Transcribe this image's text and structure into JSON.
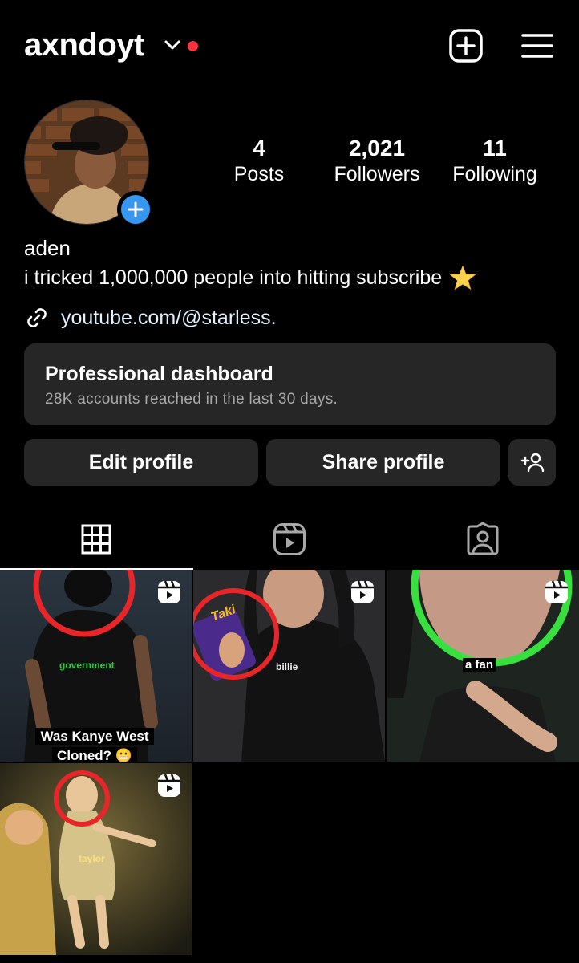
{
  "header": {
    "username": "axndoyt",
    "create_icon": "plus-square-icon",
    "menu_icon": "hamburger-menu-icon"
  },
  "profile": {
    "stats": [
      {
        "value": "4",
        "label": "Posts"
      },
      {
        "value": "2,021",
        "label": "Followers"
      },
      {
        "value": "11",
        "label": "Following"
      }
    ],
    "display_name": "aden",
    "bio": "i tricked 1,000,000 people into hitting subscribe",
    "bio_emoji": "star-icon",
    "link": "youtube.com/@starless."
  },
  "dashboard": {
    "title": "Professional dashboard",
    "subtitle": "28K accounts reached in the last 30 days."
  },
  "actions": {
    "edit": "Edit profile",
    "share": "Share profile",
    "suggest_icon": "add-person-icon"
  },
  "tabs": [
    {
      "name": "grid-icon",
      "active": true
    },
    {
      "name": "reels-icon",
      "active": false
    },
    {
      "name": "tagged-icon",
      "active": false
    }
  ],
  "posts": [
    {
      "overlay": "government",
      "caption_line1": "Was Kanye West",
      "caption_line2": "Cloned? 😬",
      "circle_color": "#e8262a"
    },
    {
      "overlay": "billie",
      "overlay2": "Taki",
      "circle_color": "#e8262a"
    },
    {
      "overlay": "a fan",
      "circle_color": "#37e03f"
    },
    {
      "overlay": "taylor",
      "circle_color": "#e8262a"
    }
  ],
  "colors": {
    "accent_blue": "#3797f0",
    "notification_red": "#ff3040",
    "surface": "#262626"
  }
}
